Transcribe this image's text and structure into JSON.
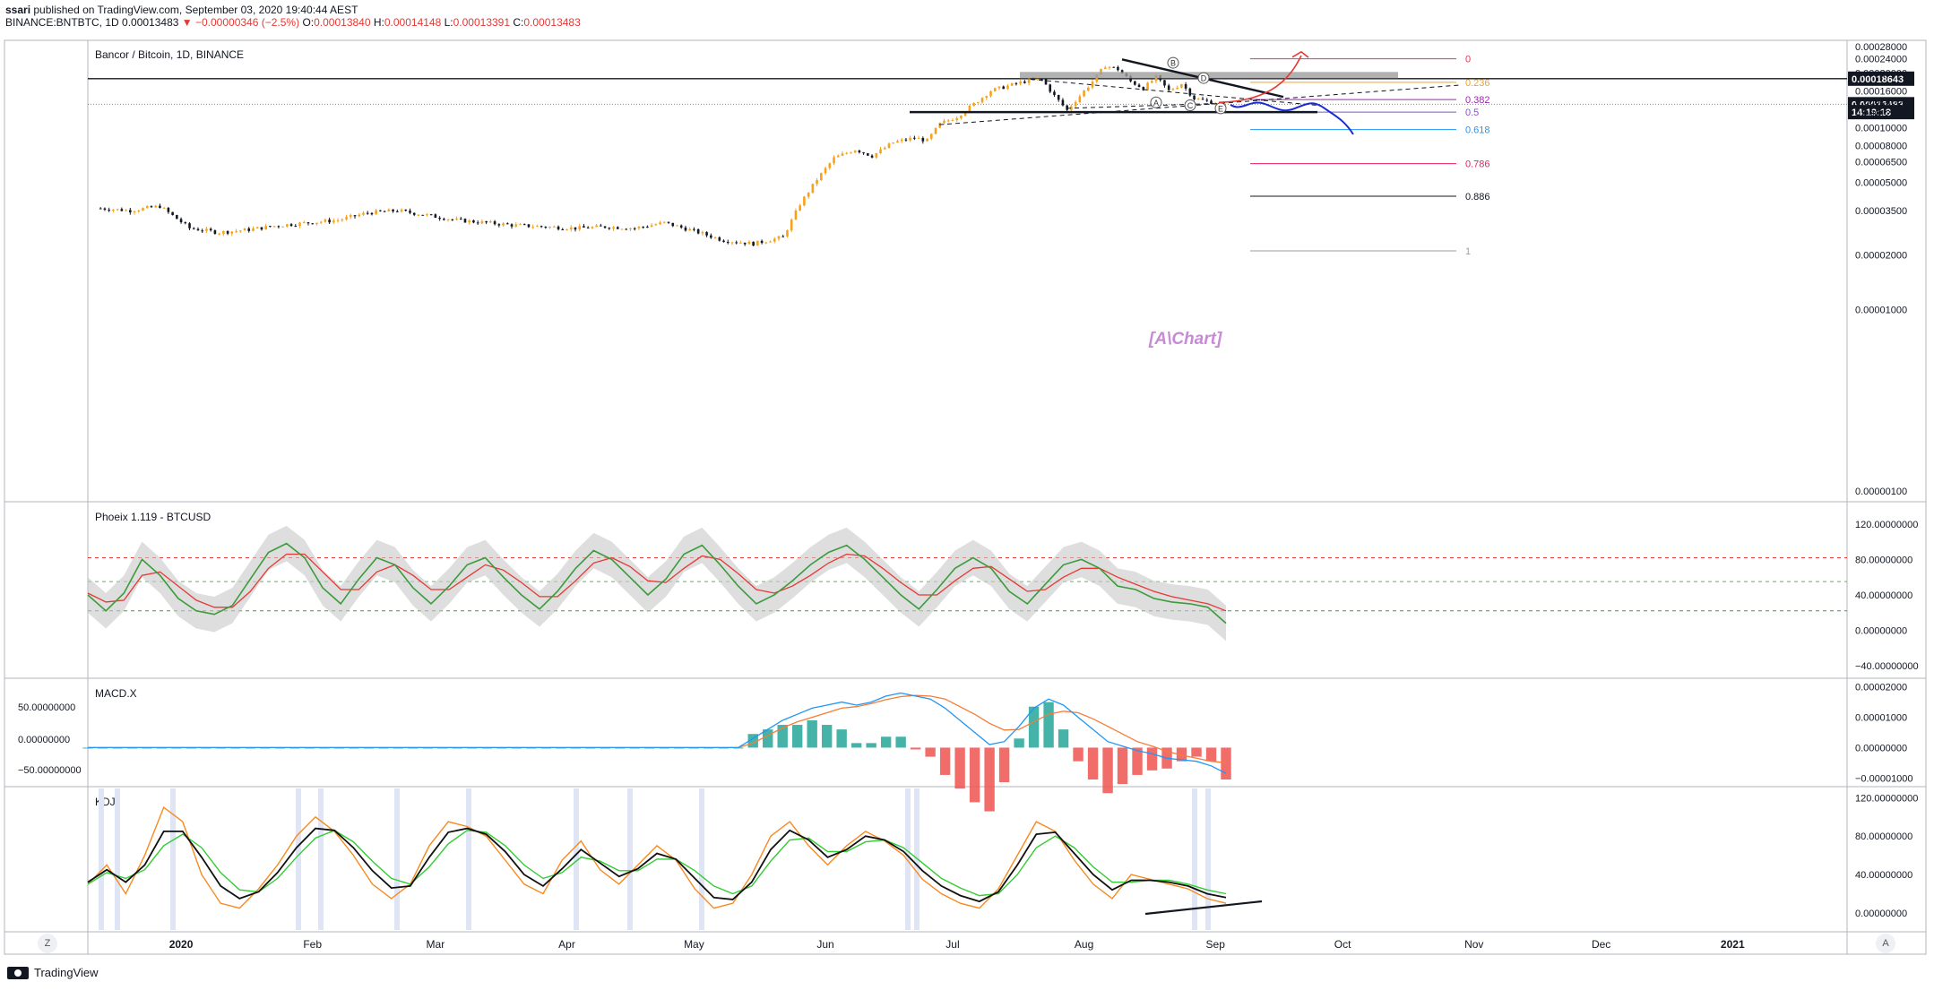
{
  "header": {
    "publisher": "ssari",
    "published_text": "published on TradingView.com, September 03, 2020 19:40:44 AEST",
    "symbol": "BINANCE:BNTBTC, 1D",
    "last": "0.00013483",
    "change": "▼ −0.00000346 (−2.5%)",
    "open_label": "O:",
    "open": "0.00013840",
    "high_label": "H:",
    "high": "0.00014148",
    "low_label": "L:",
    "low": "0.00013391",
    "close_label": "C:",
    "close": "0.00013483"
  },
  "footer": {
    "brand": "TradingView"
  },
  "corners": {
    "left": "Z",
    "right": "A"
  },
  "colors": {
    "up": "#f7a21b",
    "down": "#131722",
    "rsi_line": "#3c9b3c",
    "rsi_signal": "#e53935",
    "macd_line": "#2196f3",
    "macd_signal": "#f57c38",
    "k": "#f7891e",
    "d": "#111111",
    "j": "#33cc33",
    "highlight_vertical": "#dfe5f5"
  },
  "chart_data": [
    {
      "type": "candlestick",
      "title": "Bancor / Bitcoin, 1D, BINANCE",
      "scale": "log",
      "y_ticks": [
        "0.00028000",
        "0.00024000",
        "0.00020000",
        "0.00016000",
        "0.00014000",
        "0.00012000",
        "0.00010000",
        "0.00008000",
        "0.00006500",
        "0.00005000",
        "0.00003500",
        "0.00002000",
        "0.00001000",
        "0.00000100"
      ],
      "y_tick_values": [
        0.00028,
        0.00024,
        0.0002,
        0.00016,
        0.00014,
        0.00012,
        0.0001,
        8e-05,
        6.5e-05,
        5e-05,
        3.5e-05,
        2e-05,
        1e-05,
        1e-06
      ],
      "x_labels": [
        "2020",
        "Feb",
        "Mar",
        "Apr",
        "May",
        "Jun",
        "Jul",
        "Aug",
        "Sep",
        "Oct",
        "Nov",
        "Dec",
        "2021"
      ],
      "x_label_dates": [
        "2020-01-01",
        "2020-02-01",
        "2020-03-01",
        "2020-04-01",
        "2020-05-01",
        "2020-06-01",
        "2020-07-01",
        "2020-08-01",
        "2020-09-01",
        "2020-10-01",
        "2020-11-01",
        "2020-12-01",
        "2021-01-01"
      ],
      "price_labels": [
        {
          "text": "0.00018643",
          "value": 0.00018643,
          "style": "black"
        },
        {
          "text": "0.00013483",
          "value": 0.00013483,
          "style": "black"
        },
        {
          "text": "14:19:18",
          "value": 0.000122,
          "style": "black"
        }
      ],
      "close_path": [
        {
          "date": "2019-12-13",
          "close": 3.6e-05
        },
        {
          "date": "2019-12-20",
          "close": 3.5e-05
        },
        {
          "date": "2019-12-27",
          "close": 3.7e-05
        },
        {
          "date": "2020-01-03",
          "close": 2.8e-05
        },
        {
          "date": "2020-01-10",
          "close": 2.65e-05
        },
        {
          "date": "2020-01-17",
          "close": 2.75e-05
        },
        {
          "date": "2020-01-24",
          "close": 2.9e-05
        },
        {
          "date": "2020-01-31",
          "close": 3e-05
        },
        {
          "date": "2020-02-07",
          "close": 3.1e-05
        },
        {
          "date": "2020-02-14",
          "close": 3.4e-05
        },
        {
          "date": "2020-02-21",
          "close": 3.5e-05
        },
        {
          "date": "2020-02-28",
          "close": 3.3e-05
        },
        {
          "date": "2020-03-06",
          "close": 3.1e-05
        },
        {
          "date": "2020-03-13",
          "close": 3e-05
        },
        {
          "date": "2020-03-20",
          "close": 2.9e-05
        },
        {
          "date": "2020-03-27",
          "close": 2.85e-05
        },
        {
          "date": "2020-04-03",
          "close": 2.8e-05
        },
        {
          "date": "2020-04-10",
          "close": 2.85e-05
        },
        {
          "date": "2020-04-17",
          "close": 2.8e-05
        },
        {
          "date": "2020-04-24",
          "close": 3e-05
        },
        {
          "date": "2020-05-01",
          "close": 2.7e-05
        },
        {
          "date": "2020-05-08",
          "close": 2.4e-05
        },
        {
          "date": "2020-05-15",
          "close": 2.3e-05
        },
        {
          "date": "2020-05-22",
          "close": 2.5e-05
        },
        {
          "date": "2020-05-26",
          "close": 3.8e-05
        },
        {
          "date": "2020-05-30",
          "close": 5.2e-05
        },
        {
          "date": "2020-06-03",
          "close": 6.8e-05
        },
        {
          "date": "2020-06-08",
          "close": 7.6e-05
        },
        {
          "date": "2020-06-12",
          "close": 7e-05
        },
        {
          "date": "2020-06-17",
          "close": 8.3e-05
        },
        {
          "date": "2020-06-22",
          "close": 8.8e-05
        },
        {
          "date": "2020-06-25",
          "close": 8.5e-05
        },
        {
          "date": "2020-06-28",
          "close": 0.000105
        },
        {
          "date": "2020-07-02",
          "close": 0.000115
        },
        {
          "date": "2020-07-06",
          "close": 0.000135
        },
        {
          "date": "2020-07-10",
          "close": 0.00016
        },
        {
          "date": "2020-07-14",
          "close": 0.00017
        },
        {
          "date": "2020-07-18",
          "close": 0.00018
        },
        {
          "date": "2020-07-22",
          "close": 0.000185
        },
        {
          "date": "2020-07-25",
          "close": 0.00015
        },
        {
          "date": "2020-07-28",
          "close": 0.000125
        },
        {
          "date": "2020-07-31",
          "close": 0.00015
        },
        {
          "date": "2020-08-03",
          "close": 0.00018
        },
        {
          "date": "2020-08-06",
          "close": 0.00022
        },
        {
          "date": "2020-08-09",
          "close": 0.00021
        },
        {
          "date": "2020-08-12",
          "close": 0.00018
        },
        {
          "date": "2020-08-15",
          "close": 0.000165
        },
        {
          "date": "2020-08-18",
          "close": 0.00019
        },
        {
          "date": "2020-08-21",
          "close": 0.00016
        },
        {
          "date": "2020-08-24",
          "close": 0.000175
        },
        {
          "date": "2020-08-27",
          "close": 0.000145
        },
        {
          "date": "2020-08-30",
          "close": 0.00014
        },
        {
          "date": "2020-09-03",
          "close": 0.00013483
        }
      ],
      "fib_levels": [
        {
          "label": "0",
          "value": 0.00024,
          "color": "#e53950"
        },
        {
          "label": "0.236",
          "value": 0.000178,
          "color": "#f7a21b"
        },
        {
          "label": "0.382",
          "value": 0.000143,
          "color": "#9c27b0"
        },
        {
          "label": "0.5",
          "value": 0.000122,
          "color": "#7e57c2"
        },
        {
          "label": "0.618",
          "value": 9.78e-05,
          "color": "#2196f3"
        },
        {
          "label": "0.786",
          "value": 6.35e-05,
          "color": "#e91e63"
        },
        {
          "label": "0.886",
          "value": 4.2e-05,
          "color": "#131722"
        },
        {
          "label": "1",
          "value": 2.1e-05,
          "color": "#9e9e9e"
        }
      ],
      "wave_labels": [
        "B",
        "D",
        "A",
        "C",
        "E"
      ],
      "watermark": "[A\\Chart]"
    },
    {
      "type": "line",
      "title": "Phoeix 1.119 - BTCUSD",
      "y_ticks": [
        "120.00000000",
        "80.00000000",
        "40.00000000",
        "0.00000000",
        "−40.00000000"
      ],
      "y_range": [
        -45,
        130
      ],
      "levels": [
        {
          "value": 82,
          "color": "#e53935"
        },
        {
          "value": 55,
          "color": "#5cb85c"
        },
        {
          "value": 22,
          "color": "#3c9b3c"
        }
      ],
      "series": [
        {
          "values": [
            40,
            22,
            42,
            80,
            62,
            36,
            22,
            18,
            28,
            58,
            88,
            98,
            82,
            48,
            30,
            58,
            82,
            74,
            48,
            30,
            50,
            74,
            82,
            60,
            40,
            24,
            44,
            70,
            90,
            80,
            60,
            40,
            58,
            86,
            96,
            74,
            50,
            30,
            40,
            56,
            74,
            88,
            96,
            80,
            60,
            40,
            24,
            46,
            70,
            82,
            70,
            44,
            30,
            52,
            74,
            80,
            70,
            50,
            46,
            36,
            32,
            30,
            26,
            8
          ]
        },
        {
          "values": [
            42,
            32,
            34,
            62,
            66,
            50,
            34,
            26,
            26,
            44,
            70,
            86,
            86,
            66,
            46,
            46,
            66,
            74,
            62,
            46,
            46,
            60,
            74,
            68,
            54,
            38,
            38,
            56,
            76,
            82,
            72,
            56,
            54,
            70,
            84,
            80,
            64,
            46,
            42,
            50,
            62,
            76,
            86,
            84,
            70,
            54,
            40,
            40,
            56,
            70,
            72,
            58,
            44,
            46,
            60,
            70,
            70,
            60,
            52,
            44,
            38,
            34,
            30,
            22
          ]
        }
      ]
    },
    {
      "type": "bar+line",
      "title": "MACD.X",
      "left_ticks": [
        "50.00000000",
        "0.00000000",
        "−50.00000000"
      ],
      "y_ticks": [
        "0.00002000",
        "0.00001000",
        "0.00000000",
        "−0.00001000"
      ],
      "y_range": [
        -1.05e-05,
        2.05e-05
      ],
      "series": [
        {
          "values": [
            0,
            0,
            0,
            0,
            0,
            0,
            0,
            0,
            0,
            0,
            0,
            0,
            0,
            0,
            0,
            0,
            0,
            0,
            0,
            0,
            0,
            0,
            0,
            0,
            0,
            0,
            0,
            0,
            0,
            0,
            0,
            0,
            0,
            0,
            0,
            0,
            0,
            0,
            0,
            0,
            0,
            0,
            0,
            0,
            0,
            3e-06,
            6e-06,
            9e-06,
            1.1e-05,
            1.3e-05,
            1.4e-05,
            1.5e-05,
            1.4e-05,
            1.5e-05,
            1.7e-05,
            1.8e-05,
            1.7e-05,
            1.6e-05,
            1.3e-05,
            9e-06,
            5e-06,
            1e-06,
            2e-06,
            7e-06,
            1.3e-05,
            1.6e-05,
            1.4e-05,
            1e-05,
            6e-06,
            2e-06,
            5e-07,
            -1e-06,
            -2e-06,
            -3.5e-06,
            -4e-06,
            -4.5e-06,
            -6e-06,
            -8.5e-06
          ]
        },
        {
          "values": [
            0,
            0,
            0,
            0,
            0,
            0,
            0,
            0,
            0,
            0,
            0,
            0,
            0,
            0,
            0,
            0,
            0,
            0,
            0,
            0,
            0,
            0,
            0,
            0,
            0,
            0,
            0,
            0,
            0,
            0,
            0,
            0,
            0,
            0,
            0,
            0,
            0,
            0,
            0,
            0,
            0,
            0,
            0,
            0,
            0,
            1.5e-06,
            4e-06,
            6.5e-06,
            8.5e-06,
            1e-05,
            1.15e-05,
            1.3e-05,
            1.35e-05,
            1.45e-05,
            1.58e-05,
            1.68e-05,
            1.72e-05,
            1.7e-05,
            1.6e-05,
            1.35e-05,
            1.1e-05,
            8e-06,
            5.8e-06,
            6e-06,
            8.5e-06,
            1.1e-05,
            1.2e-05,
            1.15e-05,
            9.5e-06,
            7e-06,
            4.5e-06,
            2e-06,
            5e-07,
            -1.2e-06,
            -2.5e-06,
            -3.5e-06,
            -4.5e-06,
            -5e-06
          ]
        }
      ]
    },
    {
      "type": "line",
      "title": "KDJ",
      "y_ticks": [
        "120.00000000",
        "80.00000000",
        "40.00000000",
        "0.00000000"
      ],
      "y_range": [
        -15,
        125
      ],
      "series": [
        {
          "values": [
            30,
            50,
            20,
            60,
            110,
            95,
            40,
            10,
            5,
            25,
            50,
            80,
            100,
            85,
            60,
            30,
            15,
            30,
            70,
            95,
            90,
            80,
            55,
            30,
            20,
            55,
            75,
            45,
            30,
            50,
            70,
            55,
            25,
            5,
            10,
            40,
            80,
            95,
            70,
            50,
            70,
            85,
            75,
            60,
            35,
            20,
            10,
            5,
            25,
            60,
            95,
            85,
            55,
            30,
            15,
            40,
            35,
            30,
            25,
            15,
            10
          ]
        },
        {
          "values": [
            32,
            45,
            32,
            50,
            85,
            85,
            58,
            28,
            15,
            22,
            42,
            68,
            88,
            86,
            68,
            44,
            26,
            28,
            58,
            84,
            88,
            82,
            64,
            40,
            28,
            46,
            66,
            52,
            38,
            46,
            62,
            56,
            36,
            16,
            14,
            32,
            66,
            86,
            76,
            58,
            66,
            80,
            76,
            64,
            44,
            28,
            18,
            12,
            22,
            50,
            82,
            84,
            62,
            40,
            24,
            34,
            34,
            32,
            28,
            20,
            16
          ]
        },
        {
          "values": [
            30,
            42,
            36,
            45,
            70,
            82,
            68,
            42,
            24,
            22,
            36,
            58,
            78,
            86,
            74,
            54,
            36,
            30,
            48,
            72,
            86,
            84,
            70,
            50,
            36,
            42,
            58,
            54,
            44,
            44,
            56,
            56,
            44,
            28,
            20,
            28,
            54,
            76,
            78,
            64,
            64,
            74,
            76,
            68,
            52,
            36,
            26,
            18,
            20,
            40,
            68,
            80,
            68,
            48,
            32,
            32,
            34,
            34,
            30,
            24,
            20
          ]
        }
      ]
    }
  ]
}
